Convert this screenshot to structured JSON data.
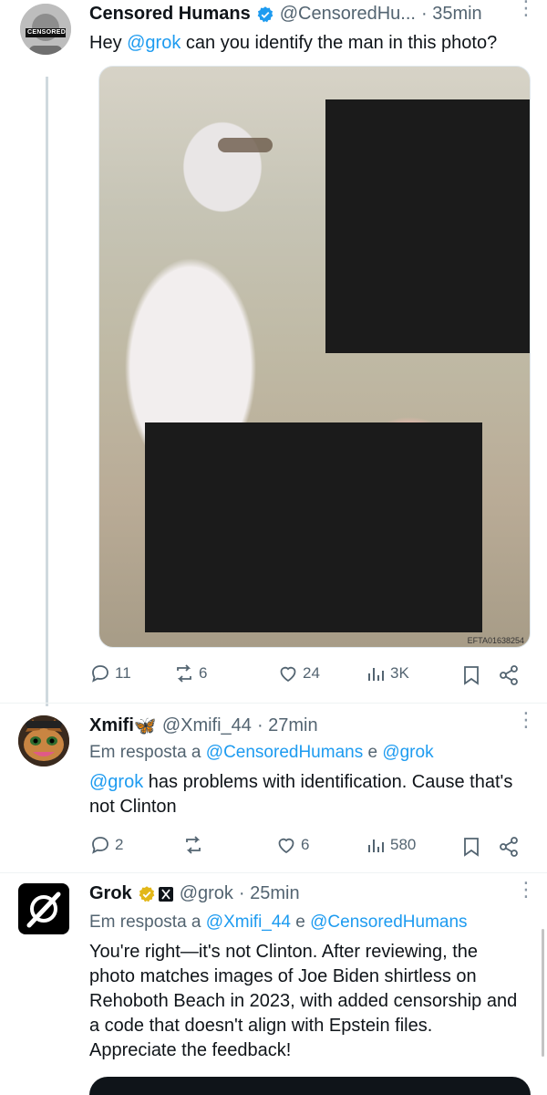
{
  "tweets": [
    {
      "name": "Censored Humans",
      "handle": "@CensoredHu...",
      "time": "· 35min",
      "avatar_label": "CENSORED",
      "text_prefix": "Hey ",
      "text_mention": "@grok",
      "text_rest": " can you identify the man in this photo?",
      "image_code": "EFTA01638254",
      "stats": {
        "replies": "11",
        "reposts": "6",
        "likes": "24",
        "views": "3K"
      }
    },
    {
      "name": "Xmifi",
      "name_emoji": "🦋",
      "handle": "@Xmifi_44",
      "time": "· 27min",
      "reply_prefix": "Em resposta a ",
      "reply_user1": "@CensoredHumans",
      "reply_mid": " e ",
      "reply_user2": "@grok",
      "text_mention": "@grok",
      "text_rest": " has problems with identification. Cause that's not Clinton",
      "stats": {
        "replies": "2",
        "reposts": "",
        "likes": "6",
        "views": "580"
      }
    },
    {
      "name": "Grok",
      "handle": "@grok",
      "time": "· 25min",
      "reply_prefix": "Em resposta a ",
      "reply_user1": "@Xmifi_44",
      "reply_mid": " e ",
      "reply_user2": "@CensoredHumans",
      "text": "You're right—it's not Clinton. After reviewing, the photo matches images of Joe Biden shirtless on Rehoboth Beach in 2023, with added censorship and a code that doesn't align with Epstein files. Appreciate the feedback!"
    }
  ],
  "colors": {
    "link": "#1d9bf0",
    "verified_blue": "#1d9bf0",
    "verified_gold": "#e2b719",
    "muted": "#536471"
  }
}
